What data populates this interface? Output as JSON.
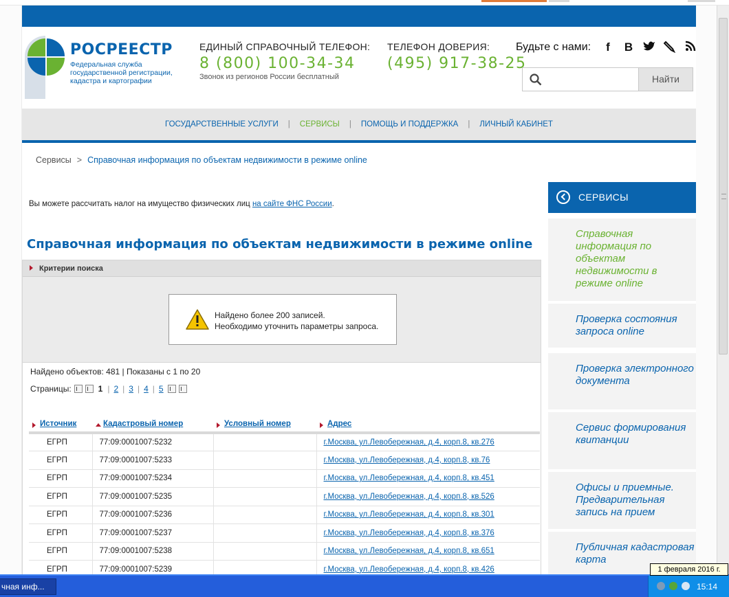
{
  "header": {
    "brand_name": "РОСРЕЕСТР",
    "brand_subtitle": "Федеральная служба государственной регистрации, кадастра и картографии",
    "hotline_label": "ЕДИНЫЙ СПРАВОЧНЫЙ ТЕЛЕФОН:",
    "hotline_number": "8 (800) 100-34-34",
    "hotline_note": "Звонок из регионов России бесплатный",
    "trust_label": "ТЕЛЕФОН ДОВЕРИЯ:",
    "trust_number": "(495) 917-38-25",
    "social_label": "Будьте с нами:",
    "social_icons": [
      "facebook-icon",
      "vkontakte-icon",
      "twitter-icon",
      "livejournal-icon",
      "rss-icon"
    ],
    "search_placeholder": "",
    "search_button": "Найти"
  },
  "nav": {
    "items": [
      "ГОСУДАРСТВЕННЫЕ УСЛУГИ",
      "СЕРВИСЫ",
      "ПОМОЩЬ И ПОДДЕРЖКА",
      "ЛИЧНЫЙ КАБИНЕТ"
    ],
    "active": "СЕРВИСЫ"
  },
  "breadcrumb": {
    "parent": "Сервисы",
    "separator": ">",
    "current": "Справочная информация по объектам недвижимости в режиме online"
  },
  "tax_note": {
    "text": "Вы можете рассчитать налог на имущество физических лиц ",
    "link": "на сайте ФНС России",
    "suffix": "."
  },
  "main": {
    "title": "Справочная информация по объектам недвижимости в режиме online",
    "criteria_label": "Критерии поиска",
    "alert_line1": "Найдено более 200 записей.",
    "alert_line2": "Необходимо уточнить параметры запроса."
  },
  "results": {
    "found_text": "Найдено объектов: 481 | Показаны с 1 по 20",
    "pages_label": "Страницы:",
    "current_page": "1",
    "pages": [
      "2",
      "3",
      "4",
      "5"
    ],
    "columns": [
      "Источник",
      "Кадастровый номер",
      "Условный номер",
      "Адрес"
    ],
    "rows": [
      {
        "source": "ЕГРП",
        "cadastral": "77:09:0001007:5232",
        "conditional": "",
        "address": "г.Москва, ул.Левобережная, д.4, корп.8, кв.276"
      },
      {
        "source": "ЕГРП",
        "cadastral": "77:09:0001007:5233",
        "conditional": "",
        "address": "г.Москва, ул.Левобережная, д.4, корп.8, кв.76"
      },
      {
        "source": "ЕГРП",
        "cadastral": "77:09:0001007:5234",
        "conditional": "",
        "address": "г.Москва, ул.Левобережная, д.4, корп.8, кв.451"
      },
      {
        "source": "ЕГРП",
        "cadastral": "77:09:0001007:5235",
        "conditional": "",
        "address": "г.Москва, ул.Левобережная, д.4, корп.8, кв.526"
      },
      {
        "source": "ЕГРП",
        "cadastral": "77:09:0001007:5236",
        "conditional": "",
        "address": "г.Москва, ул.Левобережная, д.4, корп.8, кв.301"
      },
      {
        "source": "ЕГРП",
        "cadastral": "77:09:0001007:5237",
        "conditional": "",
        "address": "г.Москва, ул.Левобережная, д.4, корп.8, кв.376"
      },
      {
        "source": "ЕГРП",
        "cadastral": "77:09:0001007:5238",
        "conditional": "",
        "address": "г.Москва, ул.Левобережная, д.4, корп.8, кв.651"
      },
      {
        "source": "ЕГРП",
        "cadastral": "77:09:0001007:5239",
        "conditional": "",
        "address": "г.Москва, ул.Левобережная, д.4, корп.8, кв.426"
      }
    ]
  },
  "sidebar": {
    "title": "СЕРВИСЫ",
    "items": [
      "Справочная информация по объектам недвижимости в режиме online",
      "Проверка состояния запроса online",
      "Проверка электронного документа",
      "Сервис формирования квитанции",
      "Офисы и приемные. Предварительная запись на прием",
      "Публичная кадастровая карта"
    ]
  },
  "taskbar": {
    "task_label": "чная инф...",
    "clock": "15:14",
    "tooltip": "1 февраля 2016 г."
  },
  "colors": {
    "brand_blue": "#0a64ae",
    "accent_green": "#6ab232",
    "alert_red": "#b3192d"
  }
}
